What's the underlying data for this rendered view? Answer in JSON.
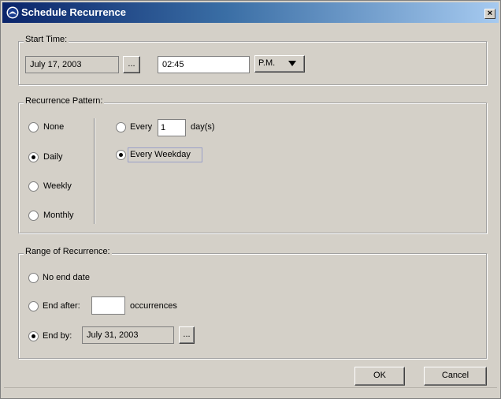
{
  "window": {
    "title": "Schedule Recurrence",
    "close_glyph": "×"
  },
  "start_time": {
    "legend": "Start Time:",
    "date_value": "July 17, 2003",
    "date_picker_label": "...",
    "time_value": "02:45",
    "ampm_value": "P.M."
  },
  "recurrence_pattern": {
    "legend": "Recurrence Pattern:",
    "options": [
      {
        "label": "None",
        "selected": false
      },
      {
        "label": "Daily",
        "selected": true
      },
      {
        "label": "Weekly",
        "selected": false
      },
      {
        "label": "Monthly",
        "selected": false
      }
    ],
    "every_label": "Every",
    "every_value": "1",
    "days_label": "day(s)",
    "every_weekday_label": "Every Weekday",
    "every_weekday_selected": true
  },
  "range_of_recurrence": {
    "legend": "Range of Recurrence:",
    "no_end_label": "No end date",
    "end_after_label": "End after:",
    "end_after_value": "",
    "occurrences_label": "occurrences",
    "end_by_label": "End by:",
    "end_by_value": "July 31, 2003",
    "end_by_picker_label": "...",
    "selected": "end_by"
  },
  "buttons": {
    "ok": "OK",
    "cancel": "Cancel"
  }
}
